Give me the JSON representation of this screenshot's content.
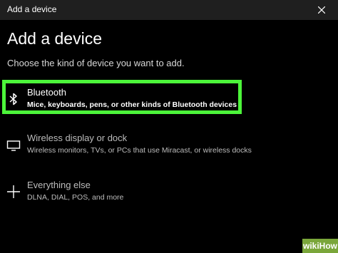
{
  "window": {
    "title": "Add a device"
  },
  "page": {
    "heading": "Add a device",
    "subheading": "Choose the kind of device you want to add."
  },
  "options": [
    {
      "label": "Bluetooth",
      "description": "Mice, keyboards, pens, or other kinds of Bluetooth devices",
      "icon": "bluetooth-icon",
      "highlighted": true
    },
    {
      "label": "Wireless display or dock",
      "description": "Wireless monitors, TVs, or PCs that use Miracast, or wireless docks",
      "icon": "monitor-icon",
      "highlighted": false
    },
    {
      "label": "Everything else",
      "description": "DLNA, DIAL, POS, and more",
      "icon": "plus-icon",
      "highlighted": false
    }
  ],
  "colors": {
    "background": "#000000",
    "titlebar": "#1f1f1f",
    "highlight": "#4cf53a",
    "watermark": "#7aa63a"
  },
  "watermark": "wikiHow"
}
